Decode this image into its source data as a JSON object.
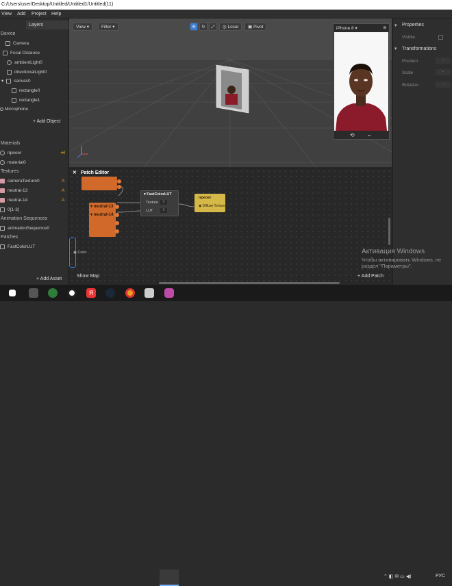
{
  "window": {
    "title": "C:/Users/user/Desktop/Untitled/Untitled1/Untitled(11)"
  },
  "menu": [
    "View",
    "Add",
    "Project",
    "Help"
  ],
  "left": {
    "layers_tab": "Layers",
    "device_header": "Device",
    "device_items": [
      "Camera",
      "Focal Distance",
      "ambientLight0",
      "directionalLight0",
      "canvas0",
      "rectangle0",
      "rectangle1",
      "Microphone"
    ],
    "add_object": "+ Add Object",
    "materials_header": "Materials",
    "materials": [
      "npeoer",
      "material0"
    ],
    "textures_header": "Textures",
    "textures": [
      "cameraTexture0",
      "neutral-13",
      "neutral-14",
      "0[1-3]"
    ],
    "anim_header": "Animation Sequences",
    "anim": [
      "animationSequence0"
    ],
    "patches_header": "Patches",
    "patches": [
      "FastColorLUT"
    ],
    "add_asset": "+ Add Asset",
    "badge_a": "A",
    "badge_arrow": "➔I"
  },
  "viewport": {
    "view": "View",
    "filter": "Filter",
    "local": "Local",
    "pivot": "Pivot"
  },
  "simulator": {
    "device": "iPhone 8",
    "menu": "≡"
  },
  "right": {
    "properties": "Properties",
    "visible": "Visible",
    "transformations": "Transformations",
    "position": "Position",
    "scale": "Scale",
    "rotation": "Rotation"
  },
  "patch_editor": {
    "title": "Patch Editor",
    "node_lut": "FastColorLUT",
    "texture_port": "Texture",
    "lut_port": "LUT",
    "port_val": "0",
    "node_neutral13": "neutral-13",
    "node_neutral14": "neutral-14",
    "material_node": "npeoer",
    "diffuse": "Diffuse Texture",
    "color": "Color",
    "show_map": "Show Map",
    "add_patch": "+ Add Patch"
  },
  "watermark": {
    "l1": "Активация Windows",
    "l2": "Чтобы активировать Windows, пе",
    "l3": "раздел \"Параметры\"."
  },
  "taskbar": {
    "lang": "РУС"
  }
}
